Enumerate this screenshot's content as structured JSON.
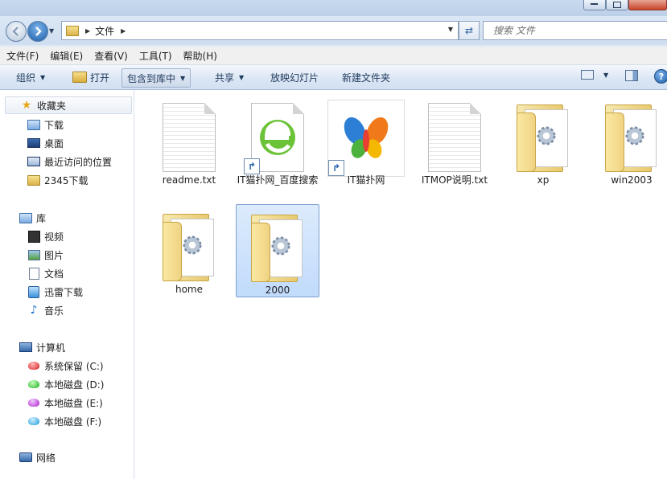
{
  "window": {
    "address": {
      "crumbs": [
        "文件"
      ]
    },
    "search": {
      "placeholder": "搜索 文件"
    }
  },
  "menubar": {
    "items": [
      "文件(F)",
      "编辑(E)",
      "查看(V)",
      "工具(T)",
      "帮助(H)"
    ]
  },
  "toolbar": {
    "organize": "组织",
    "open": "打开",
    "include_in_library": "包含到库中",
    "share": "共享",
    "slideshow": "放映幻灯片",
    "new_folder": "新建文件夹"
  },
  "navpane": {
    "favorites": {
      "label": "收藏夹",
      "items": [
        "下载",
        "桌面",
        "最近访问的位置",
        "2345下载"
      ]
    },
    "libraries": {
      "label": "库",
      "items": [
        "视频",
        "图片",
        "文档",
        "迅雷下载",
        "音乐"
      ]
    },
    "computer": {
      "label": "计算机",
      "items": [
        "系统保留 (C:)",
        "本地磁盘 (D:)",
        "本地磁盘 (E:)",
        "本地磁盘 (F:)"
      ]
    },
    "network": {
      "label": "网络"
    }
  },
  "files": [
    {
      "name": "readme.txt",
      "type": "text"
    },
    {
      "name": "IT猫扑网_百度搜索",
      "type": "shortcut-ie"
    },
    {
      "name": "IT猫扑网",
      "type": "shortcut-msn"
    },
    {
      "name": "ITMOP说明.txt",
      "type": "text"
    },
    {
      "name": "xp",
      "type": "folder"
    },
    {
      "name": "win2003",
      "type": "folder"
    },
    {
      "name": "home",
      "type": "folder"
    },
    {
      "name": "2000",
      "type": "folder",
      "selected": true
    }
  ]
}
